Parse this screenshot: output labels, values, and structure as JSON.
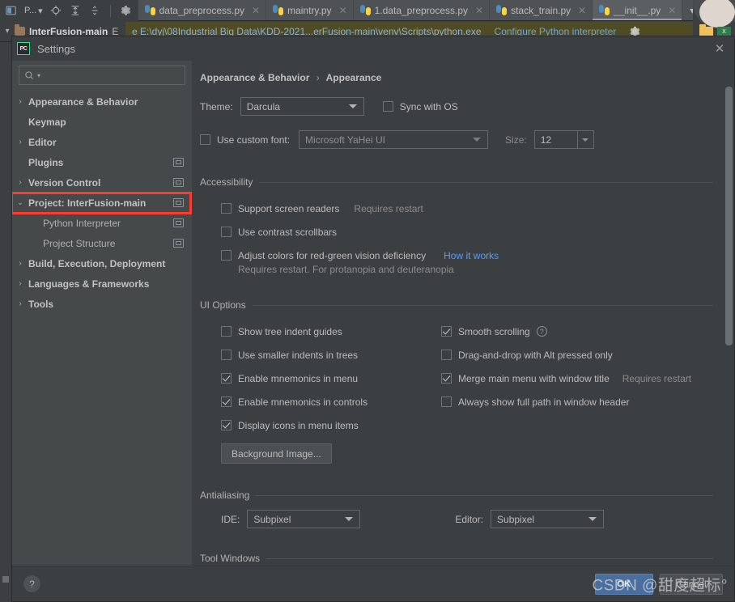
{
  "ide": {
    "toolbar_icons": [
      "project-window-icon",
      "target-icon",
      "collapse-all-icon",
      "expand-all-icon",
      "settings-gear-icon"
    ],
    "project_label": "P...",
    "nav": {
      "project_name": "InterFusion-main",
      "trailing": "E"
    },
    "editor_tabs": [
      {
        "label": "data_preprocess.py",
        "active": false
      },
      {
        "label": "maintry.py",
        "active": false
      },
      {
        "label": "1.data_preprocess.py",
        "active": false
      },
      {
        "label": "stack_train.py",
        "active": false
      },
      {
        "label": "__init__.py",
        "active": true
      }
    ],
    "tabs_overflow_icon": "chevron-down-icon",
    "interpreter_bar": {
      "path": "e E:\\dyj\\08Industrial Big Data\\KDD-2021...erFusion-main\\venv\\Scripts\\python.exe",
      "configure_link": "Configure Python interpreter",
      "gear_icon": "gear-icon"
    },
    "desktop_peek": {
      "xls_label": "X"
    }
  },
  "dialog": {
    "title": "Settings",
    "logo": "PC",
    "close_icon": "close-icon",
    "search": {
      "value": "",
      "placeholder": ""
    },
    "tree": [
      {
        "label": "Appearance & Behavior",
        "arrow": "›",
        "child": false,
        "badge": false,
        "selected": false
      },
      {
        "label": "Keymap",
        "arrow": "",
        "child": false,
        "badge": false,
        "selected": false
      },
      {
        "label": "Editor",
        "arrow": "›",
        "child": false,
        "badge": false,
        "selected": false
      },
      {
        "label": "Plugins",
        "arrow": "",
        "child": false,
        "badge": true,
        "selected": false
      },
      {
        "label": "Version Control",
        "arrow": "›",
        "child": false,
        "badge": true,
        "selected": false
      },
      {
        "label": "Project: InterFusion-main",
        "arrow": "⌄",
        "child": false,
        "badge": true,
        "selected": true
      },
      {
        "label": "Python Interpreter",
        "arrow": "",
        "child": true,
        "badge": true,
        "selected": false
      },
      {
        "label": "Project Structure",
        "arrow": "",
        "child": true,
        "badge": true,
        "selected": false
      },
      {
        "label": "Build, Execution, Deployment",
        "arrow": "›",
        "child": false,
        "badge": false,
        "selected": false
      },
      {
        "label": "Languages & Frameworks",
        "arrow": "›",
        "child": false,
        "badge": false,
        "selected": false
      },
      {
        "label": "Tools",
        "arrow": "›",
        "child": false,
        "badge": false,
        "selected": false
      }
    ],
    "breadcrumb": {
      "parent": "Appearance & Behavior",
      "sep": "›",
      "current": "Appearance"
    },
    "theme": {
      "label": "Theme:",
      "value": "Darcula",
      "sync_checkbox": {
        "label": "Sync with OS",
        "checked": false
      }
    },
    "font": {
      "use_custom_label": "Use custom font:",
      "use_custom_checked": false,
      "family": "Microsoft YaHei UI",
      "size_label": "Size:",
      "size_value": "12"
    },
    "accessibility": {
      "title": "Accessibility",
      "items": [
        {
          "label": "Support screen readers",
          "checked": false,
          "note": "Requires restart"
        },
        {
          "label": "Use contrast scrollbars",
          "checked": false,
          "note": ""
        },
        {
          "label": "Adjust colors for red-green vision deficiency",
          "checked": false,
          "link": "How it works"
        }
      ],
      "sub_note": "Requires restart. For protanopia and deuteranopia"
    },
    "ui_options": {
      "title": "UI Options",
      "left": [
        {
          "label": "Show tree indent guides",
          "checked": false
        },
        {
          "label": "Use smaller indents in trees",
          "checked": false
        },
        {
          "label": "Enable mnemonics in menu",
          "checked": true
        },
        {
          "label": "Enable mnemonics in controls",
          "checked": true
        },
        {
          "label": "Display icons in menu items",
          "checked": true
        }
      ],
      "right": [
        {
          "label": "Smooth scrolling",
          "checked": true,
          "help": true,
          "note": ""
        },
        {
          "label": "Drag-and-drop with Alt pressed only",
          "checked": false,
          "help": false,
          "note": ""
        },
        {
          "label": "Merge main menu with window title",
          "checked": true,
          "help": false,
          "note": "Requires restart"
        },
        {
          "label": "Always show full path in window header",
          "checked": false,
          "help": false,
          "note": ""
        }
      ],
      "background_image_button": "Background Image..."
    },
    "antialiasing": {
      "title": "Antialiasing",
      "ide_label": "IDE:",
      "ide_value": "Subpixel",
      "editor_label": "Editor:",
      "editor_value": "Subpixel"
    },
    "tool_windows": {
      "title": "Tool Windows"
    },
    "footer": {
      "help_icon": "?",
      "ok_label": "OK",
      "cancel_label": "Cancel"
    }
  },
  "watermark": "CSDN @甜度超标°",
  "colors": {
    "accent_blue": "#4a6f9e",
    "link_blue": "#589df6",
    "highlight_red": "#ff3b30",
    "panel_bg": "#3c3f41",
    "tree_bg": "#45494a",
    "interpreter_bar": "#4f4b23"
  }
}
